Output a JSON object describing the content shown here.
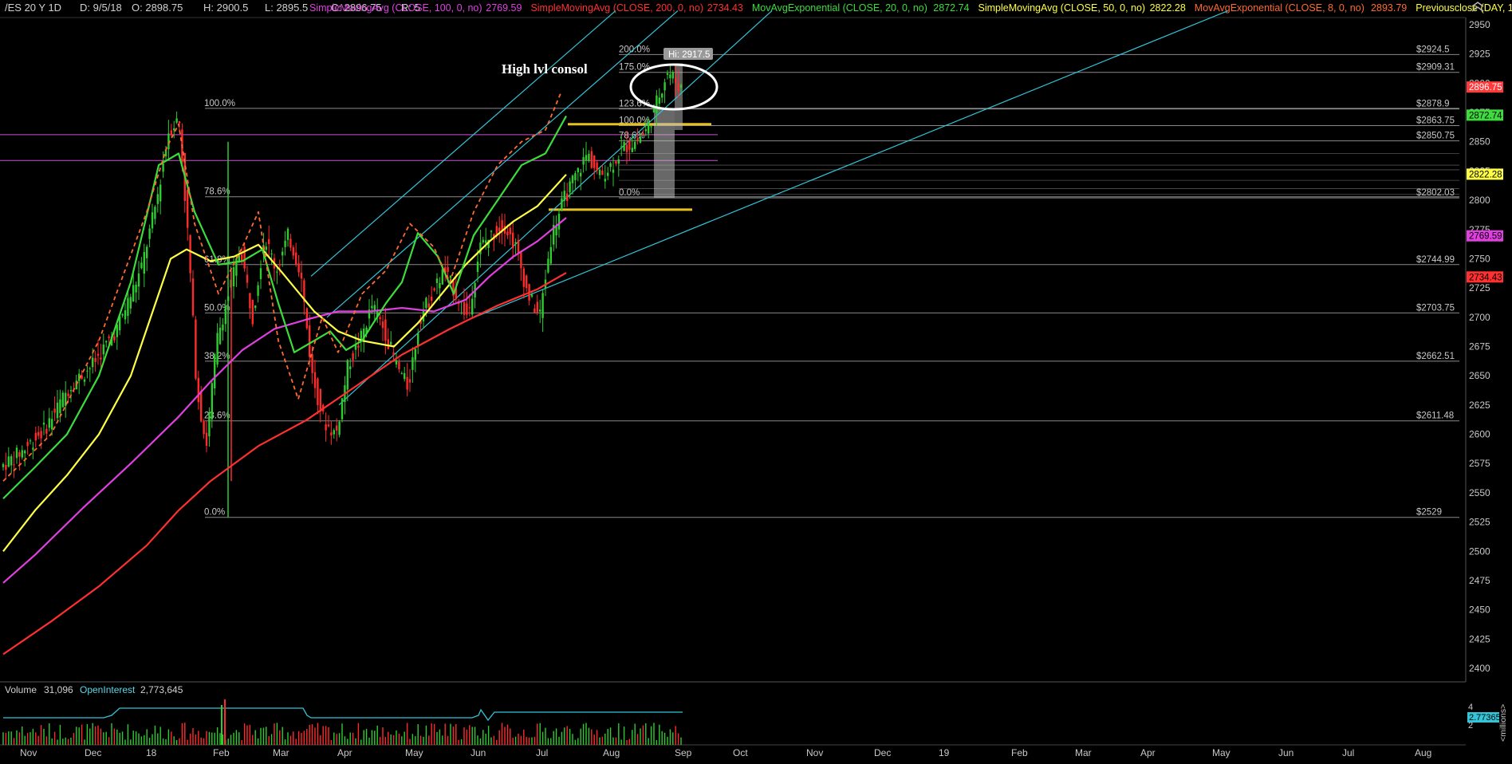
{
  "header": {
    "symbol": "/ES 20 Y 1D",
    "date": "D: 9/5/18",
    "open": "O: 2898.75",
    "high": "H: 2900.5",
    "low": "L: 2895.5",
    "close": "C: 2896.75",
    "r": "R: 5",
    "studies": [
      {
        "label": "SimpleMovingAvg (CLOSE, 100, 0, no)",
        "value": "2769.59",
        "color": "#e040e0"
      },
      {
        "label": "SimpleMovingAvg (CLOSE, 200, 0, no)",
        "value": "2734.43",
        "color": "#ff3030"
      },
      {
        "label": "MovAvgExponential (CLOSE, 20, 0, no)",
        "value": "2872.74",
        "color": "#3ddc3d"
      },
      {
        "label": "SimpleMovingAvg (CLOSE, 50, 0, no)",
        "value": "2822.28",
        "color": "#ffff44"
      },
      {
        "label": "MovAvgExponential (CLOSE, 8, 0, no)",
        "value": "2893.79",
        "color": "#ff6a30"
      },
      {
        "label": "Previousclose (DAY, 1, -1, yes)",
        "value": "",
        "color": "#ffff44"
      }
    ]
  },
  "annotation": "High lvl consol",
  "hi_label": "Hi: 2917.5",
  "volume": {
    "label": "Volume",
    "value": "31,096",
    "oi_label": "OpenInterest",
    "oi_value": "2,773,645",
    "axis_ticks": [
      "4",
      "2"
    ],
    "oi_tag": "2.77365",
    "unit": "<millions>"
  },
  "colors": {
    "background": "#000000",
    "up": "#2ecc2e",
    "down": "#ff2a2a",
    "sma100": "#e040e0",
    "sma200": "#ff3030",
    "ema20": "#3ddc3d",
    "sma50": "#ffff44",
    "ema8": "#ff6a30",
    "channel": "#33c4d8",
    "fib": "#b8b8b8",
    "magenta_lines": "#d050d0",
    "yellow_levels": "#e8c020"
  },
  "chart_data": {
    "type": "candlestick",
    "x_axis_labels": [
      "Nov",
      "Dec",
      "18",
      "Feb",
      "Mar",
      "Apr",
      "May",
      "Jun",
      "Jul",
      "Aug",
      "Sep",
      "Oct",
      "Nov",
      "Dec",
      "19",
      "Feb",
      "Mar",
      "Apr",
      "May",
      "Jun",
      "Jul",
      "Aug"
    ],
    "y_ticks": [
      2950,
      2925,
      2900,
      2875,
      2850,
      2825,
      2800,
      2775,
      2750,
      2725,
      2700,
      2675,
      2650,
      2625,
      2600,
      2575,
      2550,
      2525,
      2500,
      2475,
      2450,
      2425,
      2400
    ],
    "ylim": [
      2390,
      2962
    ],
    "price_tags": [
      {
        "value": 2896.75,
        "label": "2896.75",
        "bg": "#ff3a3a",
        "fg": "#ffffff"
      },
      {
        "value": 2872.74,
        "label": "2872.74",
        "bg": "#3ddc3d",
        "fg": "#000000"
      },
      {
        "value": 2822.28,
        "label": "2822.28",
        "bg": "#ffff44",
        "fg": "#000000"
      },
      {
        "value": 2769.59,
        "label": "2769.59",
        "bg": "#e040e0",
        "fg": "#000000"
      },
      {
        "value": 2734.43,
        "label": "2734.43",
        "bg": "#ff3030",
        "fg": "#000000"
      }
    ],
    "fib_main": [
      {
        "pct": "100.0%",
        "price": 2878.5,
        "label": ""
      },
      {
        "pct": "78.6%",
        "price": 2803.0,
        "label": ""
      },
      {
        "pct": "61.8%",
        "price": 2744.99,
        "label": "$2744.99"
      },
      {
        "pct": "50.0%",
        "price": 2703.75,
        "label": "$2703.75"
      },
      {
        "pct": "38.2%",
        "price": 2662.51,
        "label": "$2662.51"
      },
      {
        "pct": "23.6%",
        "price": 2611.48,
        "label": "$2611.48"
      },
      {
        "pct": "0.0%",
        "price": 2529.0,
        "label": "$2529"
      }
    ],
    "fib_ext": [
      {
        "pct": "200.0%",
        "price": 2924.5,
        "label": "$2924.5"
      },
      {
        "pct": "175.0%",
        "price": 2909.31,
        "label": "$2909.31"
      },
      {
        "pct": "123.6%",
        "price": 2878.0,
        "label": "$2878.9"
      },
      {
        "pct": "100.0%",
        "price": 2863.75,
        "label": "$2863.75"
      },
      {
        "pct": "78.6%",
        "price": 2850.75,
        "label": "$2850.75"
      },
      {
        "pct": "0.0%",
        "price": 2802.0,
        "label": "$2802.03"
      }
    ],
    "magenta_levels": [
      2856,
      2834
    ],
    "yellow_levels": [
      2865,
      2792
    ],
    "series": [
      {
        "name": "SimpleMovingAvg (CLOSE, 100, 0, no)",
        "points": [
          [
            0,
            2473
          ],
          [
            40,
            2497
          ],
          [
            100,
            2537
          ],
          [
            160,
            2575
          ],
          [
            220,
            2615
          ],
          [
            260,
            2645
          ],
          [
            300,
            2672
          ],
          [
            340,
            2690
          ],
          [
            380,
            2698
          ],
          [
            420,
            2705
          ],
          [
            460,
            2705
          ],
          [
            500,
            2708
          ],
          [
            540,
            2705
          ],
          [
            580,
            2715
          ],
          [
            610,
            2735
          ],
          [
            640,
            2752
          ],
          [
            670,
            2765
          ],
          [
            706,
            2785
          ]
        ]
      },
      {
        "name": "SimpleMovingAvg (CLOSE, 200, 0, no)",
        "points": [
          [
            0,
            2412
          ],
          [
            60,
            2440
          ],
          [
            120,
            2470
          ],
          [
            180,
            2505
          ],
          [
            220,
            2535
          ],
          [
            260,
            2560
          ],
          [
            320,
            2590
          ],
          [
            380,
            2612
          ],
          [
            440,
            2640
          ],
          [
            500,
            2668
          ],
          [
            560,
            2690
          ],
          [
            620,
            2710
          ],
          [
            670,
            2724
          ],
          [
            706,
            2738
          ]
        ]
      },
      {
        "name": "SimpleMovingAvg (CLOSE, 50, 0, no)",
        "points": [
          [
            0,
            2500
          ],
          [
            40,
            2535
          ],
          [
            80,
            2565
          ],
          [
            120,
            2600
          ],
          [
            160,
            2650
          ],
          [
            190,
            2710
          ],
          [
            210,
            2750
          ],
          [
            230,
            2758
          ],
          [
            260,
            2748
          ],
          [
            290,
            2752
          ],
          [
            320,
            2762
          ],
          [
            350,
            2738
          ],
          [
            390,
            2705
          ],
          [
            420,
            2688
          ],
          [
            450,
            2680
          ],
          [
            490,
            2675
          ],
          [
            520,
            2695
          ],
          [
            550,
            2720
          ],
          [
            580,
            2745
          ],
          [
            610,
            2765
          ],
          [
            640,
            2782
          ],
          [
            670,
            2795
          ],
          [
            706,
            2822
          ]
        ]
      },
      {
        "name": "MovAvgExponential (CLOSE, 20, 0, no)",
        "points": [
          [
            0,
            2545
          ],
          [
            40,
            2572
          ],
          [
            80,
            2600
          ],
          [
            120,
            2650
          ],
          [
            160,
            2730
          ],
          [
            195,
            2830
          ],
          [
            220,
            2840
          ],
          [
            240,
            2790
          ],
          [
            270,
            2745
          ],
          [
            300,
            2748
          ],
          [
            325,
            2758
          ],
          [
            345,
            2712
          ],
          [
            365,
            2670
          ],
          [
            390,
            2680
          ],
          [
            410,
            2688
          ],
          [
            430,
            2672
          ],
          [
            450,
            2680
          ],
          [
            480,
            2712
          ],
          [
            500,
            2730
          ],
          [
            520,
            2772
          ],
          [
            545,
            2752
          ],
          [
            565,
            2720
          ],
          [
            590,
            2770
          ],
          [
            620,
            2800
          ],
          [
            650,
            2830
          ],
          [
            680,
            2840
          ],
          [
            706,
            2872
          ]
        ]
      },
      {
        "name": "MovAvgExponential (CLOSE, 8, 0, no)",
        "points": [
          [
            0,
            2560
          ],
          [
            60,
            2600
          ],
          [
            120,
            2680
          ],
          [
            180,
            2790
          ],
          [
            205,
            2845
          ],
          [
            220,
            2865
          ],
          [
            240,
            2780
          ],
          [
            270,
            2720
          ],
          [
            300,
            2760
          ],
          [
            320,
            2790
          ],
          [
            345,
            2680
          ],
          [
            370,
            2630
          ],
          [
            400,
            2700
          ],
          [
            420,
            2670
          ],
          [
            450,
            2720
          ],
          [
            480,
            2740
          ],
          [
            510,
            2780
          ],
          [
            540,
            2760
          ],
          [
            560,
            2730
          ],
          [
            590,
            2790
          ],
          [
            620,
            2830
          ],
          [
            650,
            2850
          ],
          [
            680,
            2860
          ],
          [
            700,
            2893
          ]
        ]
      }
    ],
    "channel_lines": [
      {
        "from": [
          390,
          2735
        ],
        "to": [
          772,
          2962
        ]
      },
      {
        "from": [
          410,
          2700
        ],
        "to": [
          850,
          2962
        ]
      },
      {
        "from": [
          425,
          2625
        ],
        "to": [
          968,
          2962
        ]
      },
      {
        "from": [
          595,
          2700
        ],
        "to": [
          1540,
          2962
        ]
      }
    ]
  }
}
